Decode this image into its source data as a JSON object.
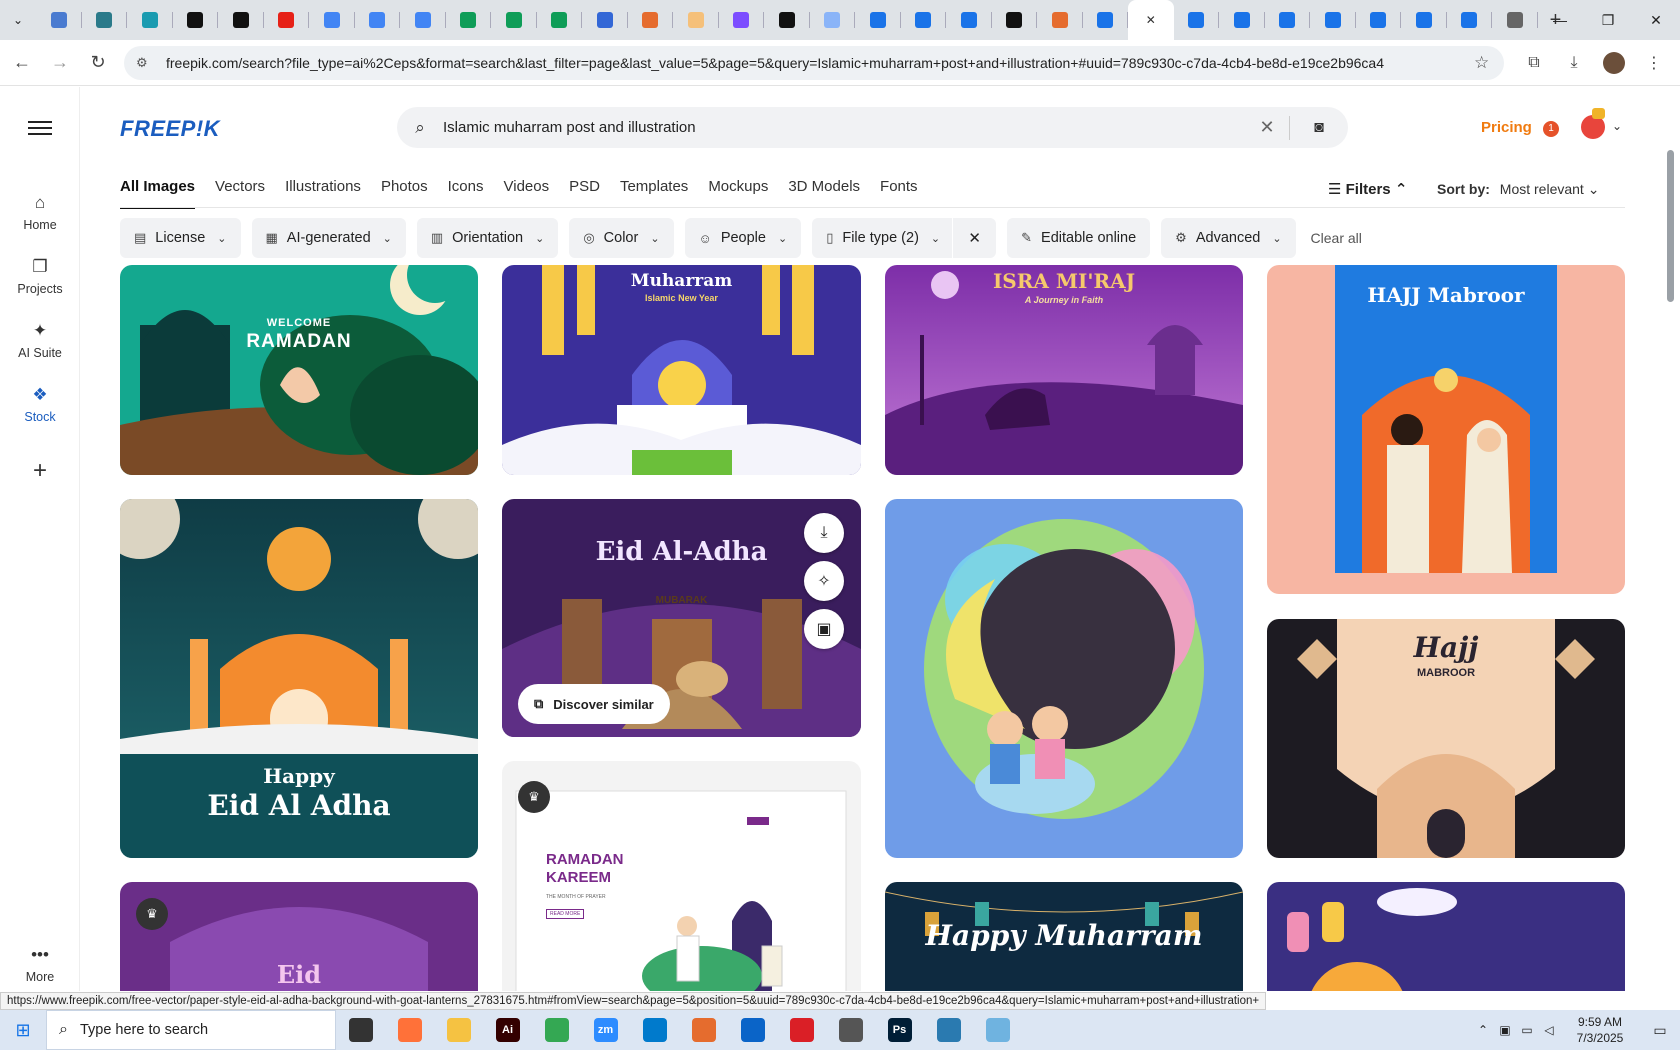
{
  "browser": {
    "url": "freepik.com/search?file_type=ai%2Ceps&format=search&last_filter=page&last_value=5&page=5&query=Islamic+muharram+post+and+illustration+#uuid=789c930c-c7da-4cb4-be8d-e19ce2b96ca4",
    "status_url": "https://www.freepik.com/free-vector/paper-style-eid-al-adha-background-with-goat-lanterns_27831675.htm#fromView=search&page=5&position=5&uuid=789c930c-c7da-4cb4-be8d-e19ce2b96ca4&query=Islamic+muharram+post+and+illustration+",
    "tabs": [
      {
        "icon": "blue-circle-icon",
        "color": "#4a7bd0"
      },
      {
        "icon": "globe-icon",
        "color": "#2a7a8a"
      },
      {
        "icon": "teal-arrow-icon",
        "color": "#1a9bb0"
      },
      {
        "icon": "openai-icon",
        "color": "#111111"
      },
      {
        "icon": "bolt-icon",
        "color": "#111111"
      },
      {
        "icon": "youtube-icon",
        "color": "#e62117"
      },
      {
        "icon": "docs-icon",
        "color": "#4285f4"
      },
      {
        "icon": "docs-icon",
        "color": "#4285f4"
      },
      {
        "icon": "docs-icon",
        "color": "#4285f4"
      },
      {
        "icon": "sheets-icon",
        "color": "#0f9d58"
      },
      {
        "icon": "sheets-icon",
        "color": "#0f9d58"
      },
      {
        "icon": "sheets-icon",
        "color": "#0f9d58"
      },
      {
        "icon": "mj-icon",
        "color": "#3367d6"
      },
      {
        "icon": "ppt-icon",
        "color": "#e56c2e"
      },
      {
        "icon": "bird-icon",
        "color": "#f5c07a"
      },
      {
        "icon": "regex-icon",
        "color": "#7c4dff"
      },
      {
        "icon": "text-icon",
        "color": "#111111"
      },
      {
        "icon": "grid-icon",
        "color": "#8ab4f8"
      },
      {
        "icon": "forms-icon",
        "color": "#1a73e8"
      },
      {
        "icon": "forms-icon",
        "color": "#1a73e8"
      },
      {
        "icon": "forms-icon",
        "color": "#1a73e8"
      },
      {
        "icon": "m-icon",
        "color": "#111111"
      },
      {
        "icon": "ppt-icon",
        "color": "#e56c2e"
      },
      {
        "icon": "forms-icon",
        "color": "#1a73e8"
      },
      {
        "icon": "freepik-tab-icon",
        "color": "#ffffff",
        "active": true
      },
      {
        "icon": "forms-icon",
        "color": "#1a73e8"
      },
      {
        "icon": "forms-icon",
        "color": "#1a73e8"
      },
      {
        "icon": "forms-icon",
        "color": "#1a73e8"
      },
      {
        "icon": "forms-icon",
        "color": "#1a73e8"
      },
      {
        "icon": "forms-icon",
        "color": "#1a73e8"
      },
      {
        "icon": "forms-icon",
        "color": "#1a73e8"
      },
      {
        "icon": "forms-icon",
        "color": "#1a73e8"
      },
      {
        "icon": "chrome-icon",
        "color": "#666666"
      }
    ]
  },
  "sidebar": {
    "items": [
      {
        "label": "Home",
        "icon": "home-icon"
      },
      {
        "label": "Projects",
        "icon": "projects-icon"
      },
      {
        "label": "AI Suite",
        "icon": "sparkle-icon"
      },
      {
        "label": "Stock",
        "icon": "stock-icon"
      },
      {
        "label": "",
        "icon": "plus-icon"
      },
      {
        "label": "More",
        "icon": "more-icon"
      }
    ]
  },
  "header": {
    "logo": "FREEP!K",
    "search_query": "Islamic muharram post and illustration",
    "pricing": "Pricing",
    "notification_count": "1"
  },
  "categories": [
    "All Images",
    "Vectors",
    "Illustrations",
    "Photos",
    "Icons",
    "Videos",
    "PSD",
    "Templates",
    "Mockups",
    "3D Models",
    "Fonts"
  ],
  "toolbar": {
    "filters_label": "Filters",
    "sort_label": "Sort by:",
    "sort_value": "Most relevant"
  },
  "filter_chips": [
    {
      "label": "License",
      "icon": "license-icon"
    },
    {
      "label": "AI-generated",
      "icon": "ai-icon"
    },
    {
      "label": "Orientation",
      "icon": "orientation-icon"
    },
    {
      "label": "Color",
      "icon": "palette-icon"
    },
    {
      "label": "People",
      "icon": "people-icon"
    },
    {
      "label": "File type (2)",
      "icon": "file-icon"
    },
    {
      "label": "Editable online",
      "icon": "pencil-icon"
    },
    {
      "label": "Advanced",
      "icon": "advanced-icon"
    }
  ],
  "clear_all": "Clear all",
  "cards": {
    "c1": {
      "title": "RAMADAN",
      "subtitle": "WELCOME",
      "bg": "#0d7e6b"
    },
    "c2": {
      "title": "Muharram",
      "subtitle": "Islamic New Year",
      "bg": "#3b2f9a"
    },
    "c3": {
      "title": "ISRA MI'RAJ",
      "subtitle": "A Journey in Faith",
      "bg": "#8a3aa8"
    },
    "c4": {
      "title": "HAJJ Mabroor",
      "bg": "#f7b6a3"
    },
    "c5": {
      "title": "Eid Al Adha",
      "subtitle": "Happy",
      "bg": "#1d5a66"
    },
    "c6": {
      "title": "Eid Al-Adha",
      "subtitle": "MUBARAK",
      "bg": "#3a1d5d",
      "discover": "Discover similar"
    },
    "c7": {
      "title": "",
      "bg": "#6f9ce8"
    },
    "c8": {
      "title": "Hajj",
      "subtitle": "MABROOR",
      "bg": "#1d1b22"
    },
    "c9": {
      "title": "RAMADAN KAREEM",
      "subtitle": "THE MONTH OF PRAYER",
      "button": "READ MORE",
      "bg": "#ffffff"
    },
    "c10": {
      "title": "Eid",
      "bg": "#6a2e88"
    },
    "c11": {
      "title": "Happy Muharram",
      "bg": "#0e2a40"
    },
    "c12": {
      "title": "",
      "bg": "#3a2f82"
    }
  },
  "taskbar": {
    "search_placeholder": "Type here to search",
    "time": "9:59 AM",
    "date": "7/3/2025",
    "apps": [
      {
        "icon": "task-view-icon",
        "color": "#333333"
      },
      {
        "icon": "firefox-icon",
        "color": "#ff7139"
      },
      {
        "icon": "file-explorer-icon",
        "color": "#f5c242"
      },
      {
        "icon": "illustrator-icon",
        "color": "#330000"
      },
      {
        "icon": "chrome-icon",
        "color": "#34a853"
      },
      {
        "icon": "zoom-icon",
        "color": "#2d8cff"
      },
      {
        "icon": "vscode-icon",
        "color": "#007acc"
      },
      {
        "icon": "powerpoint-like-icon",
        "color": "#e56c2e"
      },
      {
        "icon": "outlook-icon",
        "color": "#0a64c8"
      },
      {
        "icon": "creative-cloud-icon",
        "color": "#da1f26"
      },
      {
        "icon": "pen-icon",
        "color": "#555555"
      },
      {
        "icon": "photoshop-icon",
        "color": "#001e36"
      },
      {
        "icon": "app-diamond-icon",
        "color": "#2a7ab0"
      },
      {
        "icon": "notepad-icon",
        "color": "#6fb3e0"
      }
    ]
  }
}
